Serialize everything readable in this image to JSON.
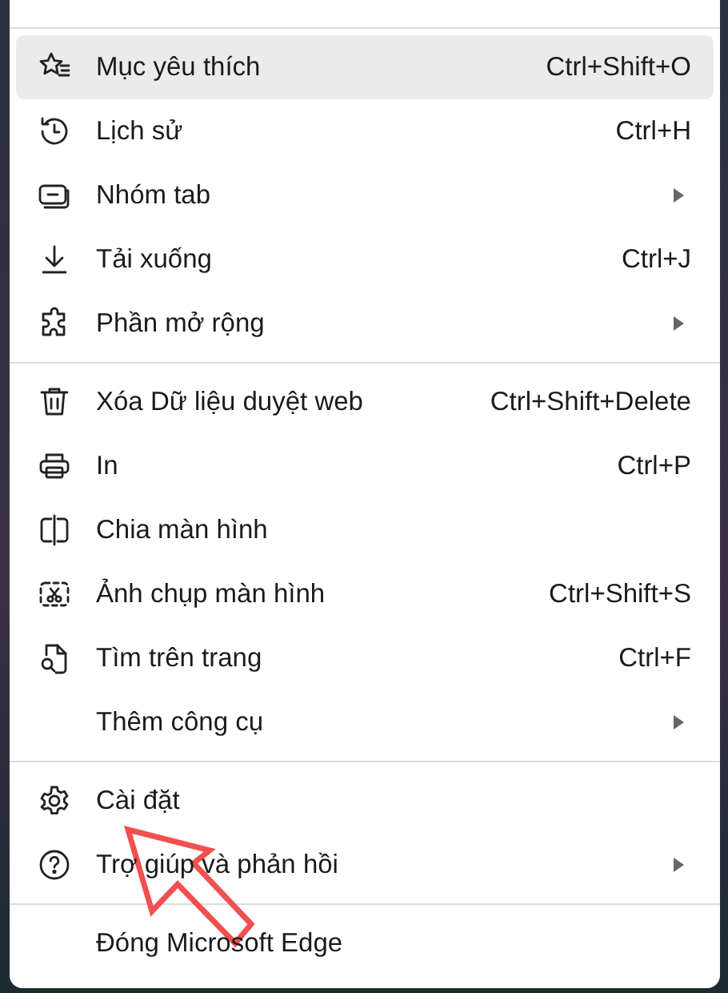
{
  "menu": {
    "groups": [
      {
        "items": [
          {
            "label": "Mục yêu thích",
            "shortcut": "Ctrl+Shift+O",
            "submenu": false,
            "selected": true
          },
          {
            "label": "Lịch sử",
            "shortcut": "Ctrl+H",
            "submenu": false,
            "selected": false
          },
          {
            "label": "Nhóm tab",
            "submenu": true,
            "selected": false
          },
          {
            "label": "Tải xuống",
            "shortcut": "Ctrl+J",
            "submenu": false,
            "selected": false
          },
          {
            "label": "Phần mở rộng",
            "submenu": true,
            "selected": false
          }
        ]
      },
      {
        "items": [
          {
            "label": "Xóa Dữ liệu duyệt web",
            "shortcut": "Ctrl+Shift+Delete",
            "submenu": false,
            "selected": false
          },
          {
            "label": "In",
            "shortcut": "Ctrl+P",
            "submenu": false,
            "selected": false
          },
          {
            "label": "Chia màn hình",
            "submenu": false,
            "selected": false
          },
          {
            "label": "Ảnh chụp màn hình",
            "shortcut": "Ctrl+Shift+S",
            "submenu": false,
            "selected": false
          },
          {
            "label": "Tìm trên trang",
            "shortcut": "Ctrl+F",
            "submenu": false,
            "selected": false
          },
          {
            "label": "Thêm công cụ",
            "submenu": true,
            "selected": false
          }
        ]
      },
      {
        "items": [
          {
            "label": "Cài đặt",
            "submenu": false,
            "selected": false
          },
          {
            "label": "Trợ giúp và phản hồi",
            "submenu": true,
            "selected": false
          }
        ]
      },
      {
        "items": [
          {
            "label": "Đóng Microsoft Edge",
            "submenu": false,
            "selected": false
          }
        ]
      }
    ]
  }
}
